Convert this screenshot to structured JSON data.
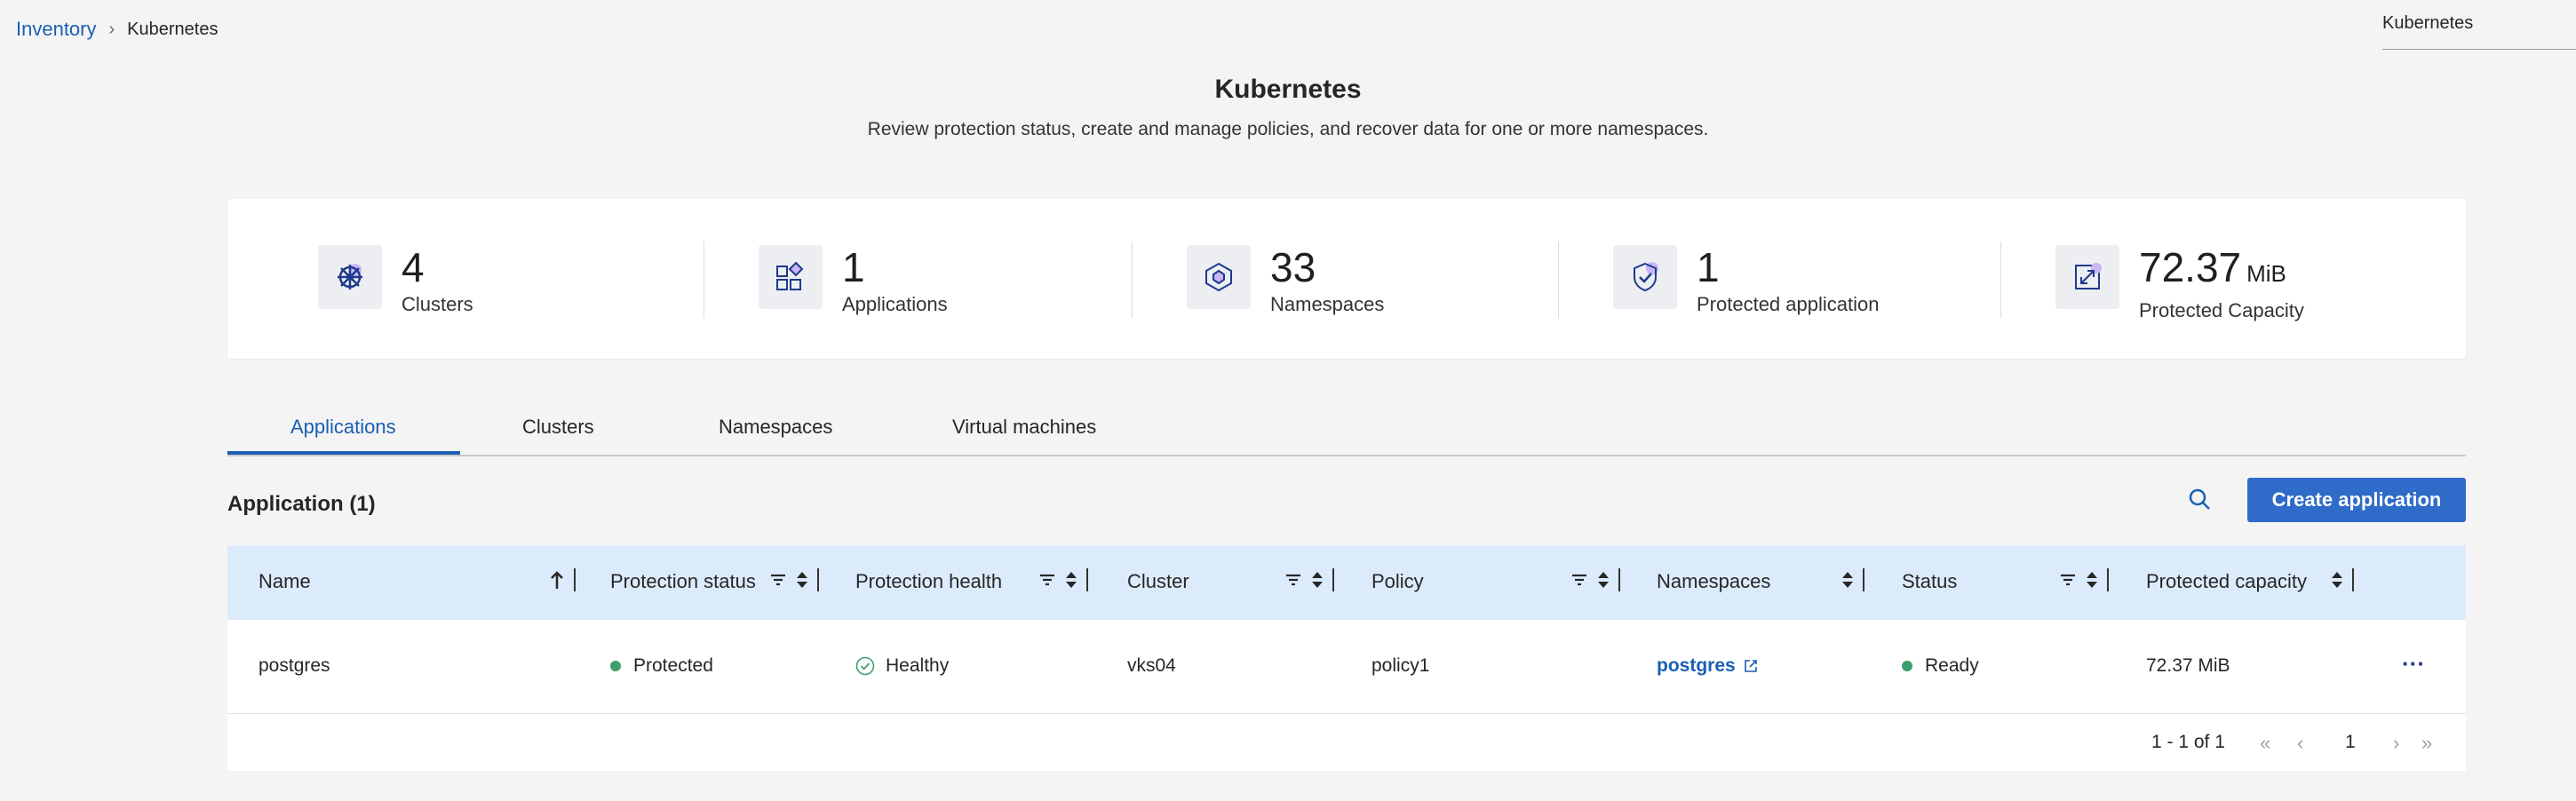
{
  "breadcrumb": {
    "root": "Inventory",
    "current": "Kubernetes"
  },
  "top_select": {
    "value": "Kubernetes"
  },
  "header": {
    "title": "Kubernetes",
    "subtitle": "Review protection status, create and manage policies, and recover data for one or more namespaces."
  },
  "summary": [
    {
      "value": "4",
      "unit": "",
      "label": "Clusters",
      "icon": "kubernetes-wheel-icon"
    },
    {
      "value": "1",
      "unit": "",
      "label": "Applications",
      "icon": "applications-icon"
    },
    {
      "value": "33",
      "unit": "",
      "label": "Namespaces",
      "icon": "namespace-cube-icon"
    },
    {
      "value": "1",
      "unit": "",
      "label": "Protected application",
      "icon": "shield-check-icon"
    },
    {
      "value": "72.37",
      "unit": "MiB",
      "label": "Protected Capacity",
      "icon": "capacity-icon"
    }
  ],
  "tabs": [
    "Applications",
    "Clusters",
    "Namespaces",
    "Virtual machines"
  ],
  "section": {
    "title": "Application (1)",
    "create_label": "Create application"
  },
  "table": {
    "columns": [
      "Name",
      "Protection status",
      "Protection health",
      "Cluster",
      "Policy",
      "Namespaces",
      "Status",
      "Protected capacity"
    ],
    "rows": [
      {
        "name": "postgres",
        "protection_status": "Protected",
        "protection_health": "Healthy",
        "cluster": "vks04",
        "policy": "policy1",
        "namespaces": "postgres",
        "status": "Ready",
        "protected_capacity": "72.37 MiB",
        "more": "···"
      }
    ]
  },
  "pagination": {
    "range": "1 - 1 of 1",
    "page": "1"
  },
  "colors": {
    "accent": "#1a5fb4",
    "button": "#2f6bc8",
    "header_bg": "#dcebfb",
    "status_green": "#3d9f6d",
    "icon_purple": "#8b5cf6"
  }
}
